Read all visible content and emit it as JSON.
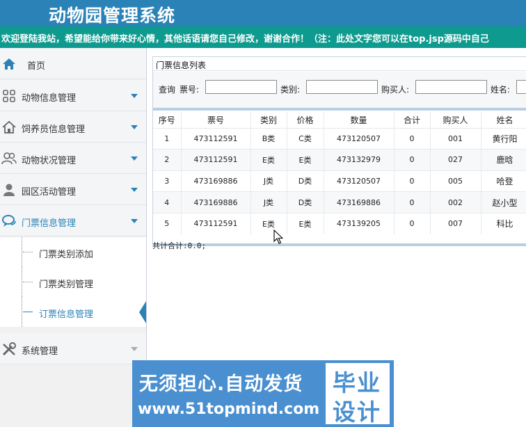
{
  "header": {
    "title": "动物园管理系统"
  },
  "marquee": {
    "text": "欢迎登陆我站，希望能给你带来好心情，其他话语请您自己修改，谢谢合作！（注：此处文字您可以在top.jsp源码中自己"
  },
  "sidebar": {
    "items": [
      {
        "label": "首页",
        "icon": "home-icon"
      },
      {
        "label": "动物信息管理",
        "icon": "grid-icon"
      },
      {
        "label": "饲养员信息管理",
        "icon": "house-icon"
      },
      {
        "label": "动物状况管理",
        "icon": "users-icon"
      },
      {
        "label": "园区活动管理",
        "icon": "user-icon"
      },
      {
        "label": "门票信息管理",
        "icon": "chat-icon"
      },
      {
        "label": "系统管理",
        "icon": "tools-icon"
      }
    ],
    "subitems": [
      {
        "label": "门票类别添加"
      },
      {
        "label": "门票类别管理"
      },
      {
        "label": "订票信息管理"
      }
    ]
  },
  "panel": {
    "title": "门票信息列表",
    "search": {
      "query_label": "查询",
      "ticket_no_label": "票号:",
      "category_label": "类别:",
      "buyer_label": "购买人:",
      "name_label": "姓名:"
    },
    "columns": [
      "序号",
      "票号",
      "类别",
      "价格",
      "数量",
      "合计",
      "购买人",
      "姓名"
    ],
    "rows": [
      [
        "1",
        "473112591",
        "B类",
        "C类",
        "473120507",
        "0",
        "001",
        "黄行阳"
      ],
      [
        "2",
        "473112591",
        "E类",
        "E类",
        "473132979",
        "0",
        "027",
        "鹿晗"
      ],
      [
        "3",
        "473169886",
        "J类",
        "D类",
        "473120507",
        "0",
        "005",
        "哈登"
      ],
      [
        "4",
        "473169886",
        "J类",
        "D类",
        "473169886",
        "0",
        "002",
        "赵小型"
      ],
      [
        "5",
        "473112591",
        "E类",
        "E类",
        "473139205",
        "0",
        "007",
        "科比"
      ]
    ],
    "total_text": "共计合计:0.0;"
  },
  "watermark": {
    "line1": "无须担心.自动发货",
    "line2": "www.51topmind.com",
    "badge_top": "毕业",
    "badge_bottom": "设计"
  },
  "colors": {
    "header": "#2a82b6",
    "marquee": "#0e9a8e",
    "accent": "#2a82b6",
    "watermark": "#4a8fd0"
  }
}
